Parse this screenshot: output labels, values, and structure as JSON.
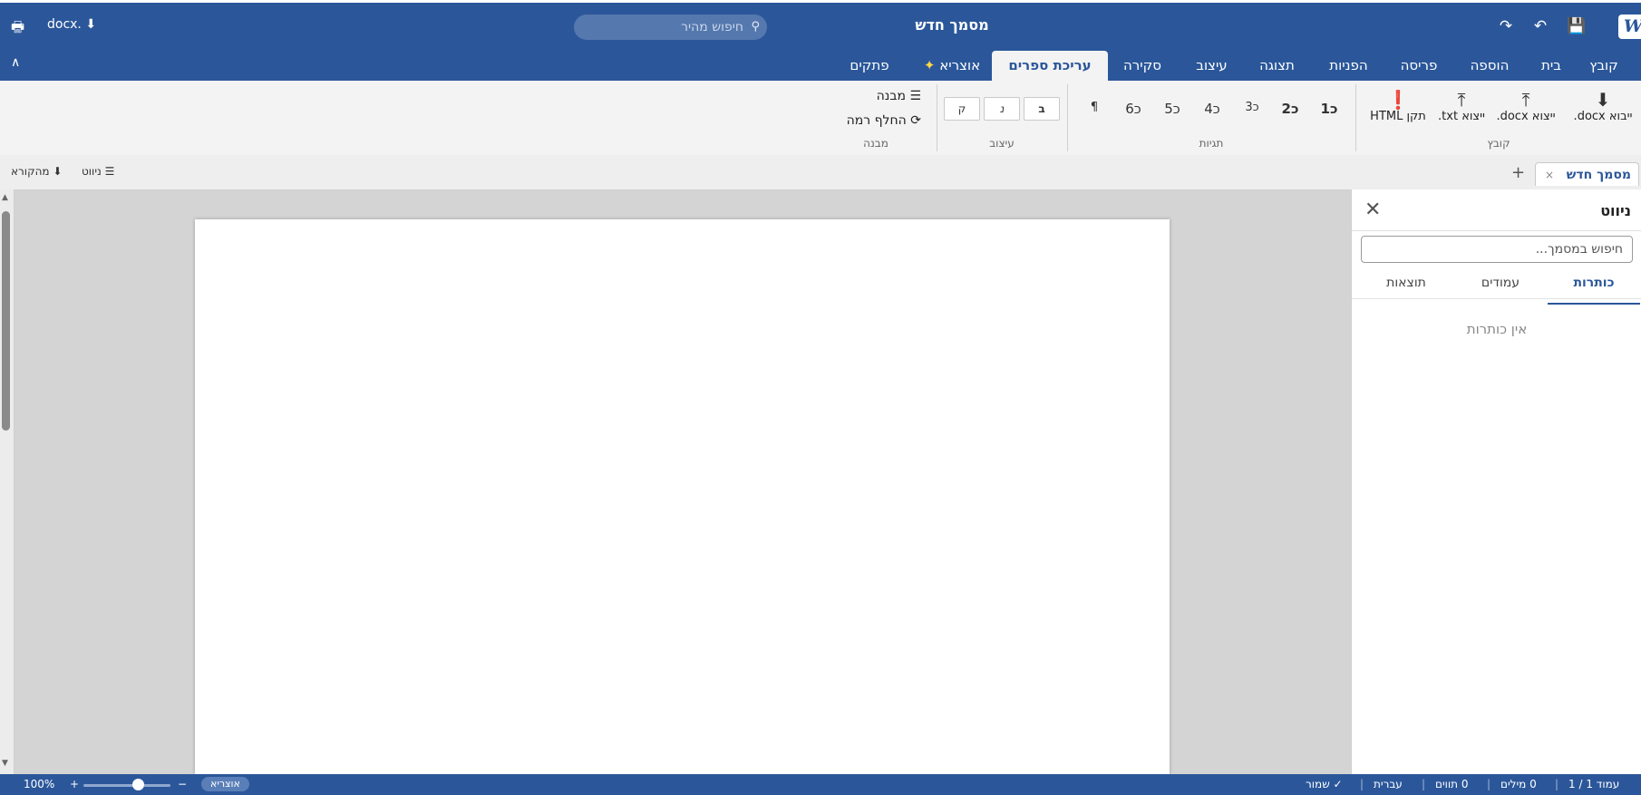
{
  "app": {
    "logo": "W",
    "doc_title": "מסמך חדש"
  },
  "titlebar": {
    "search_placeholder": "חיפוש מהיר",
    "docx_label": "docx.",
    "save_icon": "💾",
    "undo_icon": "↶",
    "redo_icon": "↷",
    "print_icon": "🖶",
    "download_icon": "⬇",
    "search_icon": "⚲"
  },
  "menu_tabs": [
    {
      "label": "קובץ"
    },
    {
      "label": "בית"
    },
    {
      "label": "הוספה"
    },
    {
      "label": "פריסה"
    },
    {
      "label": "הפניות"
    },
    {
      "label": "תצוגה"
    },
    {
      "label": "עיצוב"
    },
    {
      "label": "סקירה"
    },
    {
      "label": "עריכת ספרים"
    },
    {
      "label": "אוצריא",
      "prefix": "✦"
    },
    {
      "label": "פתקים"
    }
  ],
  "collapse_icon": "∧",
  "ribbon": {
    "file_group": {
      "label": "קובץ",
      "buttons": [
        "ייבוא docx.",
        "ייצוא docx.",
        "ייצוא txt.",
        "תקן HTML"
      ]
    },
    "tags_group": {
      "label": "תגיות",
      "headings": [
        "כ1",
        "כ2",
        "כ3",
        "כ4",
        "כ5",
        "כ6",
        "¶"
      ]
    },
    "format_group": {
      "label": "עיצוב",
      "buttons": [
        "ב",
        "נ",
        "ק"
      ]
    },
    "structure_group": {
      "label": "מבנה",
      "items": [
        "מבנה",
        "החלף רמה"
      ]
    }
  },
  "doctabs": {
    "active_tab": "מסמך חדש",
    "close": "×",
    "add": "+",
    "nav_label": "ניווט",
    "source_label": "מהקורא"
  },
  "navpane": {
    "title": "ניווט",
    "close": "✕",
    "search_placeholder": "חיפוש במסמך...",
    "tabs": [
      "כותרות",
      "עמודים",
      "תוצאות"
    ],
    "empty_text": "אין כותרות"
  },
  "status": {
    "page": "עמוד 1 / 1",
    "words": "0 מילים",
    "chars": "0 תווים",
    "lang": "עברית",
    "saved": "✓ שמור",
    "badge": "אוצריא",
    "zoom": "100%",
    "zoom_in": "+",
    "zoom_out": "−",
    "zoom_level": 0.65
  }
}
